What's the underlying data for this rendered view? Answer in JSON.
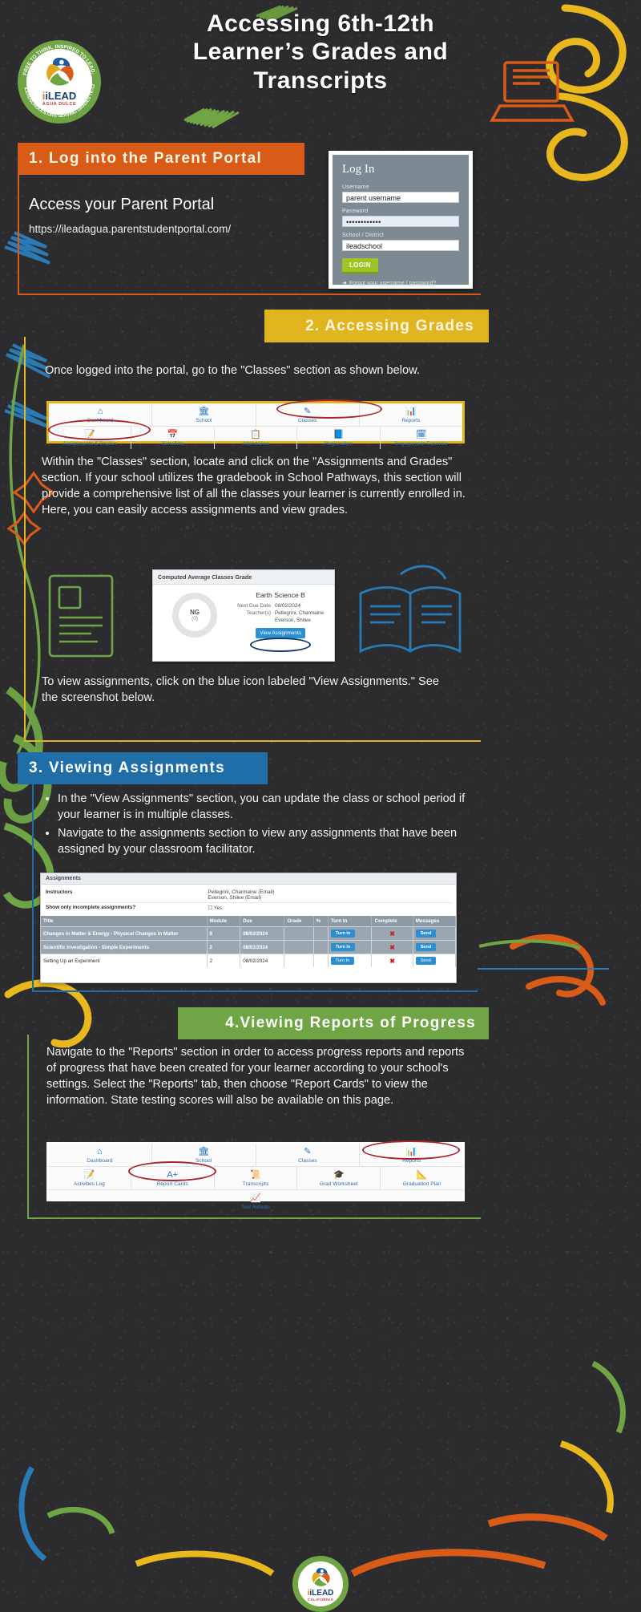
{
  "header": {
    "title_line1": "Accessing 6th-12th",
    "title_line2": "Learner’s Grades and",
    "title_line3": "Transcripts",
    "logo_word": "iLEAD",
    "logo_sub": "AGUA DULCE",
    "logo_ring_top": "FREE TO THINK.  INSPIRED TO LEAD.",
    "logo_ring_bottom": "ILEADSCHOOLS.ORG   SERVING GRADES TK-12"
  },
  "colors": {
    "orange": "#d95b18",
    "yellow": "#e0b51f",
    "blue": "#1f6ea8",
    "green": "#6fa544",
    "board": "#2c2c2e",
    "login_green": "#9fc425",
    "portal_blue": "#2d8fd0",
    "annotate_red": "#a6262b"
  },
  "section1": {
    "band": "1. Log into the Parent Portal",
    "heading": "Access your Parent Portal",
    "url": "https://ileadagua.parentstudentportal.com/",
    "login": {
      "title": "Log In",
      "username_label": "Username",
      "username_value": "parent username",
      "password_label": "Password",
      "password_value": "••••••••••••",
      "school_label": "School / District",
      "school_value": "ileadschool",
      "login_button": "LOGIN",
      "forgot_arrow": "➜",
      "forgot_link": "Forgot your username / password?"
    }
  },
  "section2": {
    "band": "2.  Accessing Grades",
    "intro": "Once logged into the portal, go to the \"Classes\" section as shown below.",
    "nav": {
      "row1": [
        {
          "icon": "⌂",
          "label": "Dashboard",
          "name": "dashboard"
        },
        {
          "icon": "🏛",
          "label": "School",
          "name": "school"
        },
        {
          "icon": "✎",
          "label": "Classes",
          "name": "classes"
        },
        {
          "icon": "📊",
          "label": "Reports",
          "name": "reports"
        }
      ],
      "row2": [
        {
          "icon": "📝",
          "label": "Assignments & Grades",
          "name": "assignments-grades"
        },
        {
          "icon": "📅",
          "label": "Schedule",
          "name": "schedule"
        },
        {
          "icon": "📋",
          "label": "Attendance",
          "name": "attendance"
        },
        {
          "icon": "📘",
          "label": "Registration",
          "name": "registration"
        },
        {
          "icon": "🗓",
          "label": "Engagement Calendar",
          "name": "engagement-calendar"
        }
      ]
    },
    "paragraph": "Within the \"Classes\" section, locate and click on the \"Assignments and Grades\" section. If your school utilizes the gradebook in School Pathways, this section will provide a comprehensive list of all the classes your learner is currently enrolled in. Here, you can easily access assignments and view  grades.",
    "grade_card": {
      "header": "Computed Average Classes Grade",
      "donut_grade": "NG",
      "donut_pct": "(0)",
      "class_name": "Earth Science B",
      "rows": [
        {
          "key": "Next Due Date",
          "value": "08/02/2024"
        },
        {
          "key": "Teacher(s)",
          "value": "Pellegrini, Charmaine"
        },
        {
          "key": "",
          "value": "Everson, Shilee"
        }
      ],
      "button": "View Assignments"
    },
    "closing": "To view assignments, click on the blue icon labeled \"View Assignments.\" See the screenshot below."
  },
  "section3": {
    "band": "3.  Viewing Assignments",
    "bullets": [
      "In the \"View Assignments\" section, you can update the class or school period if your learner is in multiple classes.",
      "Navigate to the assignments section to view any assignments that have been assigned by your classroom facilitator."
    ],
    "table_shot": {
      "title": "Assignments",
      "meta": [
        {
          "key": "Instructors",
          "value": "Pellegrini, Charmaine (Email)",
          "value2": "Everson, Shilee (Email)"
        },
        {
          "key": "Show only incomplete assignments?",
          "value": "☐ Yes",
          "value2": ""
        }
      ],
      "columns": [
        "Title",
        "Module",
        "Due",
        "Grade",
        "%",
        "Turn In",
        "Complete",
        "Messages"
      ],
      "rows": [
        {
          "title": "Changes in Matter & Energy - Physical Changes in Matter",
          "module": "8",
          "due": "08/02/2024",
          "grade": "",
          "pct": "",
          "turn_in": "Turn In",
          "complete": "✖",
          "messages": "Send",
          "shaded": true
        },
        {
          "title": "Scientific Investigation - Simple Experiments",
          "module": "2",
          "due": "08/02/2024",
          "grade": "",
          "pct": "",
          "turn_in": "Turn In",
          "complete": "✖",
          "messages": "Send",
          "shaded": true
        },
        {
          "title": "Setting Up an Experiment",
          "module": "2",
          "due": "08/02/2024",
          "grade": "",
          "pct": "",
          "turn_in": "Turn In",
          "complete": "✖",
          "messages": "Send",
          "shaded": false
        }
      ]
    }
  },
  "section4": {
    "band": "4.Viewing Reports of Progress",
    "paragraph": "Navigate to the \"Reports\" section in order to access progress reports and reports of progress that have been created for your learner according to your school's settings. Select the \"Reports\" tab, then choose \"Report Cards\" to view the information. State testing scores will also be available on this page.",
    "nav": {
      "row1": [
        {
          "icon": "⌂",
          "label": "Dashboard",
          "name": "dashboard"
        },
        {
          "icon": "🏛",
          "label": "School",
          "name": "school"
        },
        {
          "icon": "✎",
          "label": "Classes",
          "name": "classes"
        },
        {
          "icon": "📊",
          "label": "Reports",
          "name": "reports"
        }
      ],
      "row2": [
        {
          "icon": "📝",
          "label": "Activities Log",
          "name": "activities-log"
        },
        {
          "icon": "A+",
          "label": "Report Cards",
          "name": "report-cards"
        },
        {
          "icon": "📜",
          "label": "Transcripts",
          "name": "transcripts"
        },
        {
          "icon": "🎓",
          "label": "Grad Worksheet",
          "name": "grad-worksheet"
        },
        {
          "icon": "📐",
          "label": "Graduation Plan",
          "name": "graduation-plan"
        }
      ],
      "row3": [
        {
          "icon": "📈",
          "label": "Test Results",
          "name": "test-results"
        }
      ]
    }
  },
  "footer": {
    "logo_word": "iLEAD",
    "logo_sub": "CALIFORNIA"
  }
}
